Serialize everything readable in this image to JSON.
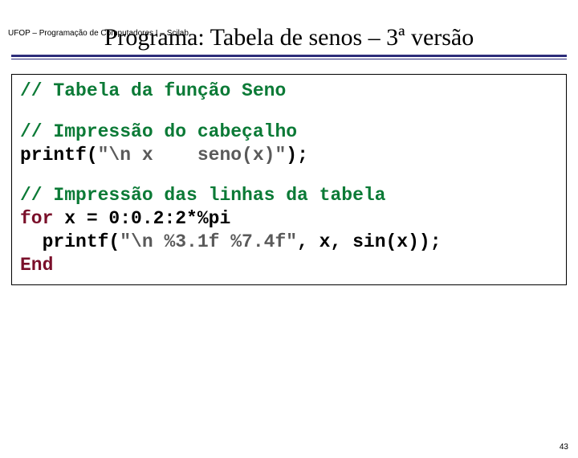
{
  "header": {
    "course": "UFOP – Programação de Computadores I – Scilab"
  },
  "title": "Programa: Tabela de senos – 3ª versão",
  "code": {
    "block1": {
      "comment": "// Tabela da função Seno"
    },
    "block2": {
      "comment": "// Impressão do cabeçalho",
      "call": "printf(",
      "string": "\"\\n x    seno(x)\"",
      "after": ");"
    },
    "block3": {
      "comment": "// Impressão das linhas da tabela",
      "for_kw": "for",
      "for_rest": " x = 0:0.2:2*%pi",
      "print_start": "  printf(",
      "print_str": "\"\\n %3.1f %7.4f\"",
      "print_rest": ", x, sin(x));",
      "end_kw": "End"
    }
  },
  "page_number": "43"
}
